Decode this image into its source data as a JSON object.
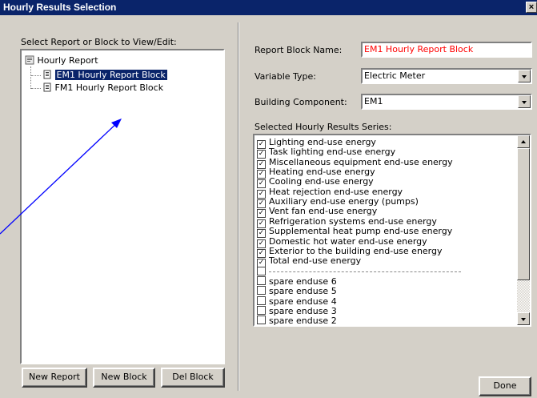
{
  "window": {
    "title": "Hourly Results Selection",
    "close_glyph": "×"
  },
  "left": {
    "label": "Select Report or Block to View/Edit:",
    "tree": {
      "root": "Hourly Report",
      "children": [
        {
          "label": "EM1 Hourly Report Block",
          "selected": true
        },
        {
          "label": "FM1 Hourly Report Block",
          "selected": false
        }
      ]
    },
    "buttons": {
      "new_report": "New Report",
      "new_block": "New Block",
      "del_block": "Del Block"
    }
  },
  "right": {
    "report_block_name_label": "Report Block Name:",
    "report_block_name_value": "EM1 Hourly Report Block",
    "variable_type_label": "Variable Type:",
    "variable_type_value": "Electric Meter",
    "building_component_label": "Building Component:",
    "building_component_value": "EM1",
    "series_label": "Selected Hourly Results Series:",
    "series": [
      {
        "label": "Lighting end-use energy",
        "checked": true
      },
      {
        "label": "Task lighting end-use energy",
        "checked": true
      },
      {
        "label": "Miscellaneous equipment end-use energy",
        "checked": true
      },
      {
        "label": "Heating end-use energy",
        "checked": true
      },
      {
        "label": "Cooling end-use energy",
        "checked": true
      },
      {
        "label": "Heat rejection end-use energy",
        "checked": true
      },
      {
        "label": "Auxiliary end-use energy (pumps)",
        "checked": true
      },
      {
        "label": "Vent fan end-use energy",
        "checked": true
      },
      {
        "label": "Refrigeration systems end-use energy",
        "checked": true
      },
      {
        "label": "Supplemental heat pump end-use energy",
        "checked": true
      },
      {
        "label": "Domestic hot water end-use energy",
        "checked": true
      },
      {
        "label": "Exterior to the building end-use energy",
        "checked": true
      },
      {
        "label": "Total end-use energy",
        "checked": true
      },
      {
        "label": "",
        "checked": false,
        "separator": true
      },
      {
        "label": "spare enduse 6",
        "checked": false
      },
      {
        "label": "spare enduse 5",
        "checked": false
      },
      {
        "label": "spare enduse 4",
        "checked": false
      },
      {
        "label": "spare enduse 3",
        "checked": false
      },
      {
        "label": "spare enduse 2",
        "checked": false
      }
    ],
    "done_label": "Done"
  },
  "colors": {
    "title_bar": "#0a246a",
    "name_value_text": "#ff0000",
    "annotation_arrow": "#0000ff"
  }
}
